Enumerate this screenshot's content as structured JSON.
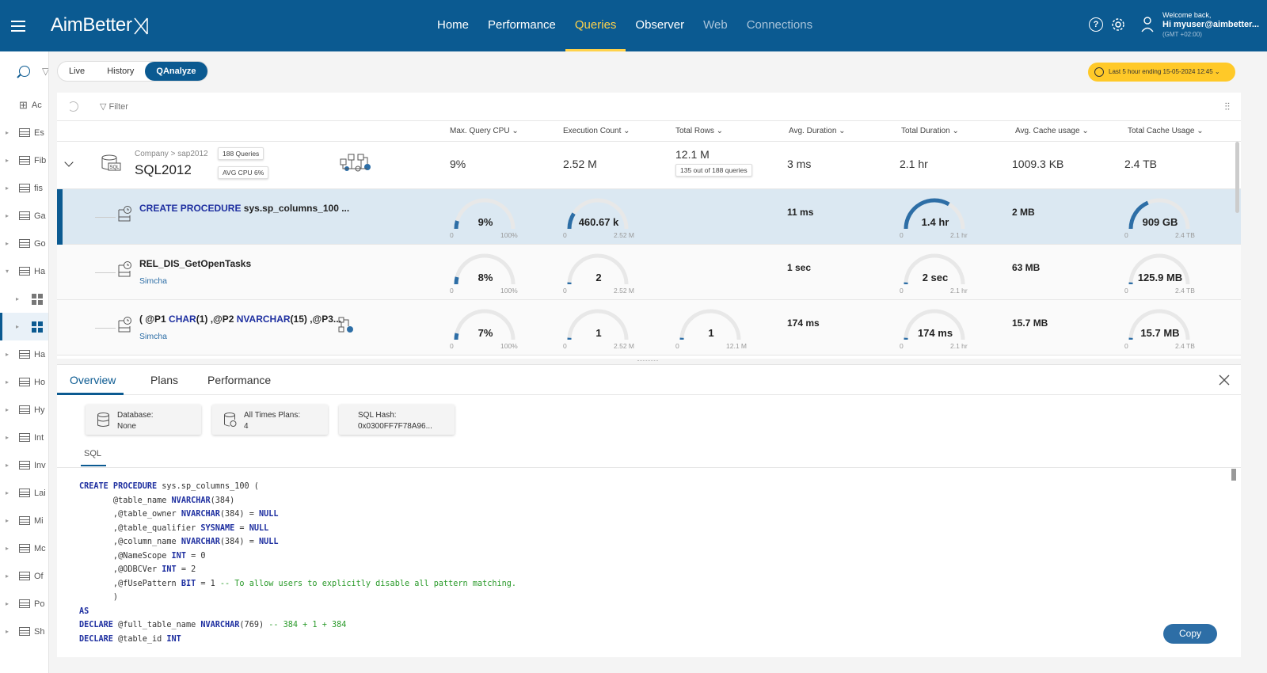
{
  "app": {
    "logo": "AimBetter"
  },
  "nav": [
    {
      "label": "Home",
      "state": "normal"
    },
    {
      "label": "Performance",
      "state": "normal"
    },
    {
      "label": "Queries",
      "state": "active"
    },
    {
      "label": "Observer",
      "state": "normal"
    },
    {
      "label": "Web",
      "state": "dim"
    },
    {
      "label": "Connections",
      "state": "dim"
    }
  ],
  "user": {
    "welcome": "Welcome back,",
    "name": "Hi myuser@aimbetter...",
    "tz": "(GMT +02:00)"
  },
  "sidebar": {
    "items": [
      {
        "label": "Ac",
        "kind": "grid"
      },
      {
        "label": "Es",
        "kind": "db"
      },
      {
        "label": "Fib",
        "kind": "db"
      },
      {
        "label": "fis",
        "kind": "db"
      },
      {
        "label": "Ga",
        "kind": "db"
      },
      {
        "label": "Go",
        "kind": "db"
      },
      {
        "label": "Ha",
        "kind": "db-open"
      },
      {
        "label": "",
        "kind": "win"
      },
      {
        "label": "",
        "kind": "win-sel"
      },
      {
        "label": "Ha",
        "kind": "db"
      },
      {
        "label": "Ho",
        "kind": "db"
      },
      {
        "label": "Hy",
        "kind": "db"
      },
      {
        "label": "Int",
        "kind": "db"
      },
      {
        "label": "Inv",
        "kind": "db"
      },
      {
        "label": "Lai",
        "kind": "db"
      },
      {
        "label": "Mi",
        "kind": "db"
      },
      {
        "label": "Mc",
        "kind": "db"
      },
      {
        "label": "Of",
        "kind": "db"
      },
      {
        "label": "Po",
        "kind": "db"
      },
      {
        "label": "Sh",
        "kind": "db"
      }
    ]
  },
  "modes": {
    "live": "Live",
    "history": "History",
    "qanalyze": "QAnalyze"
  },
  "timerange": "Last 5 hour ending  15-05-2024 12:45",
  "filter": {
    "label": "Filter"
  },
  "columns": [
    "Max. Query CPU",
    "Execution Count",
    "Total Rows",
    "Avg. Duration",
    "Total Duration",
    "Avg. Cache usage",
    "Total Cache Usage"
  ],
  "group": {
    "crumb": "Company > sap2012",
    "name": "SQL2012",
    "queries_tag": "188 Queries",
    "cpu_tag": "AVG CPU 6%",
    "max_cpu": "9%",
    "exec_count": "2.52 M",
    "total_rows": "12.1 M",
    "rows_note": "135 out of 188 queries",
    "avg_duration": "3 ms",
    "total_duration": "2.1 hr",
    "avg_cache": "1009.3 KB",
    "total_cache": "2.4 TB"
  },
  "queries": [
    {
      "title_kw": "CREATE PROCEDURE",
      "title_rest": " sys.sp_columns_100 ...",
      "sub": "",
      "cpu": {
        "label": "9%",
        "frac": 0.09,
        "max": "100%"
      },
      "exec": {
        "label": "460.67 k",
        "frac": 0.18,
        "max": "2.52 M"
      },
      "rows": null,
      "avg_duration": "11 ms",
      "total_duration": {
        "label": "1.4 hr",
        "frac": 0.67,
        "max": "2.1 hr"
      },
      "avg_cache": "2 MB",
      "total_cache": {
        "label": "909 GB",
        "frac": 0.37,
        "max": "2.4 TB"
      }
    },
    {
      "title_kw": "",
      "title_rest": "REL_DIS_GetOpenTasks",
      "sub": "Simcha",
      "cpu": {
        "label": "8%",
        "frac": 0.08,
        "max": "100%"
      },
      "exec": {
        "label": "2",
        "frac": 0,
        "max": "2.52 M"
      },
      "rows": null,
      "avg_duration": "1 sec",
      "total_duration": {
        "label": "2 sec",
        "frac": 0,
        "max": "2.1 hr"
      },
      "avg_cache": "63 MB",
      "total_cache": {
        "label": "125.9 MB",
        "frac": 0,
        "max": "2.4 TB"
      }
    },
    {
      "title_kw": "",
      "title_rest": "( @P1 CHAR(1) ,@P2 NVARCHAR(15) ,@P3...",
      "sub": "Simcha",
      "cpu": {
        "label": "7%",
        "frac": 0.07,
        "max": "100%"
      },
      "exec": {
        "label": "1",
        "frac": 0,
        "max": "2.52 M"
      },
      "rows": {
        "label": "1",
        "frac": 0,
        "max": "12.1 M"
      },
      "avg_duration": "174 ms",
      "total_duration": {
        "label": "174 ms",
        "frac": 0,
        "max": "2.1 hr"
      },
      "avg_cache": "15.7 MB",
      "total_cache": {
        "label": "15.7 MB",
        "frac": 0.01,
        "max": "2.4 TB"
      }
    }
  ],
  "details": {
    "tabs": [
      "Overview",
      "Plans",
      "Performance"
    ],
    "cards": [
      {
        "label": "Database:",
        "value": "None"
      },
      {
        "label": "All Times Plans:",
        "value": "4"
      },
      {
        "label": "SQL Hash:",
        "value": "0x0300FF7F78A96..."
      }
    ],
    "sql_tab": "SQL",
    "copy": "Copy",
    "sql_lines": [
      "CREATE PROCEDURE sys.sp_columns_100 (",
      "\t@table_name NVARCHAR(384)",
      "\t,@table_owner NVARCHAR(384) = NULL",
      "\t,@table_qualifier SYSNAME = NULL",
      "\t,@column_name NVARCHAR(384) = NULL",
      "\t,@NameScope INT = 0",
      "\t,@ODBCVer INT = 2",
      "\t,@fUsePattern BIT = 1 -- To allow users to explicitly disable all pattern matching.",
      "\t)",
      "AS",
      "DECLARE @full_table_name NVARCHAR(769) -- 384 + 1 + 384",
      "DECLARE @table_id INT"
    ]
  }
}
